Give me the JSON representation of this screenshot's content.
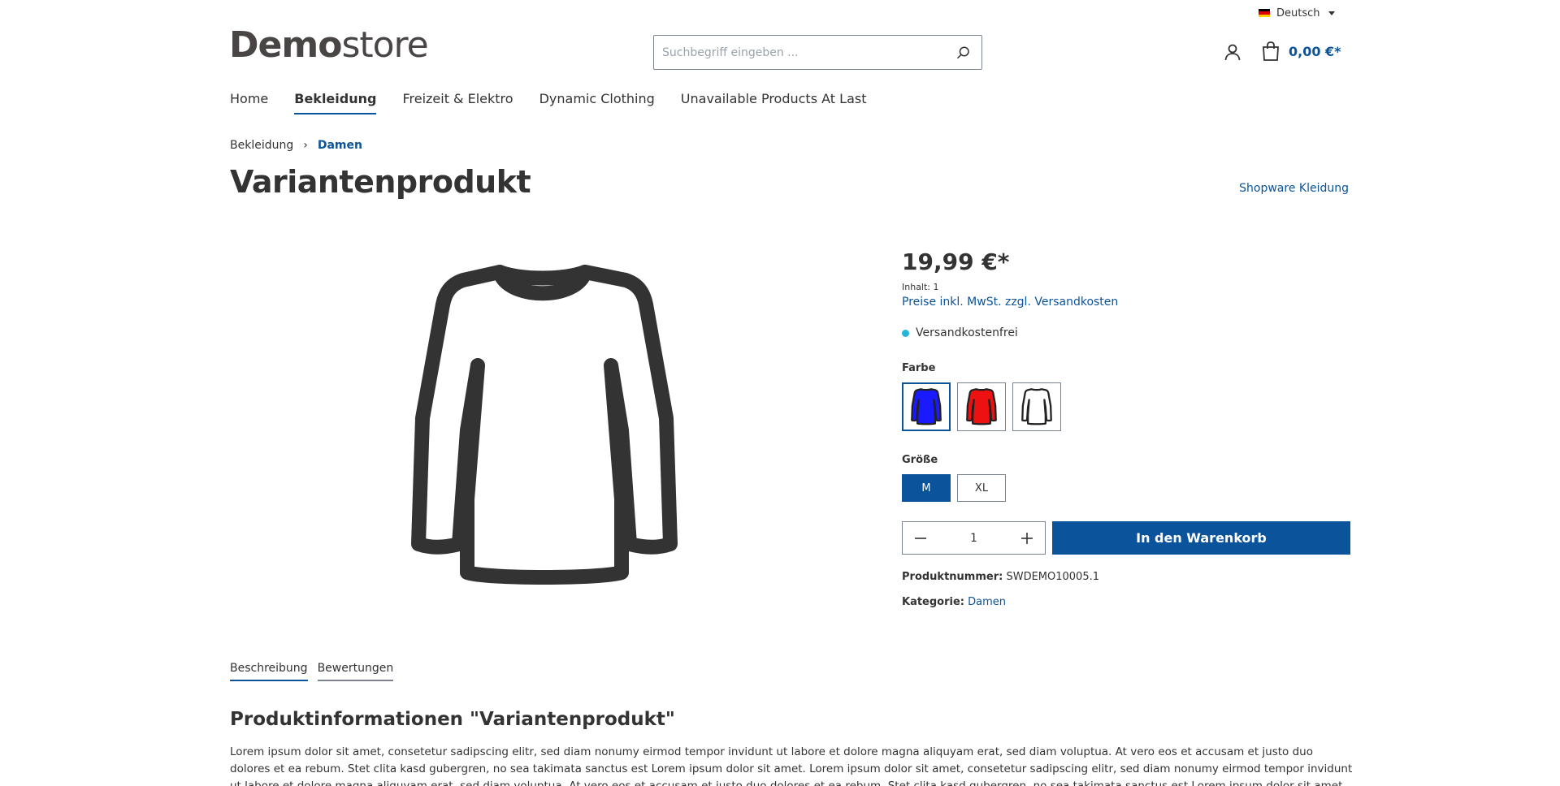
{
  "language": {
    "label": "Deutsch",
    "flag_colors": [
      "#000000",
      "#dd0000",
      "#ffce00"
    ]
  },
  "logo": {
    "bold": "Demo",
    "light": "store"
  },
  "search": {
    "placeholder": "Suchbegriff eingeben ..."
  },
  "cart": {
    "total": "0,00 €*"
  },
  "nav": {
    "items": [
      {
        "label": "Home",
        "active": false
      },
      {
        "label": "Bekleidung",
        "active": true
      },
      {
        "label": "Freizeit & Elektro",
        "active": false
      },
      {
        "label": "Dynamic Clothing",
        "active": false
      },
      {
        "label": "Unavailable Products At Last",
        "active": false
      }
    ]
  },
  "breadcrumb": {
    "parent": "Bekleidung",
    "separator": "›",
    "current": "Damen"
  },
  "product": {
    "title": "Variantenprodukt",
    "manufacturer": "Shopware Kleidung",
    "price": "19,99 €*",
    "unit": "Inhalt: 1",
    "tax_note": "Preise inkl. MwSt. zzgl. Versandkosten",
    "delivery": "Versandkostenfrei",
    "delivery_color": "#26b4d9",
    "color_group": "Farbe",
    "colors": [
      {
        "name": "blue",
        "fill": "#1a1aff",
        "selected": true
      },
      {
        "name": "red",
        "fill": "#ee1111",
        "selected": false
      },
      {
        "name": "white",
        "fill": "#ffffff",
        "selected": false
      }
    ],
    "size_group": "Größe",
    "sizes": [
      {
        "label": "M",
        "selected": true
      },
      {
        "label": "XL",
        "selected": false
      }
    ],
    "quantity": "1",
    "add_to_cart": "In den Warenkorb",
    "number_label": "Produktnummer:",
    "number_value": "SWDEMO10005.1",
    "category_label": "Kategorie:",
    "category_value": "Damen"
  },
  "tabs": [
    {
      "label": "Beschreibung",
      "active": true
    },
    {
      "label": "Bewertungen",
      "active": false
    }
  ],
  "description": {
    "heading": "Produktinformationen \"Variantenprodukt\"",
    "text": "Lorem ipsum dolor sit amet, consetetur sadipscing elitr, sed diam nonumy eirmod tempor invidunt ut labore et dolore magna aliquyam erat, sed diam voluptua. At vero eos et accusam et justo duo dolores et ea rebum. Stet clita kasd gubergren, no sea takimata sanctus est Lorem ipsum dolor sit amet. Lorem ipsum dolor sit amet, consetetur sadipscing elitr, sed diam nonumy eirmod tempor invidunt ut labore et dolore magna aliquyam erat, sed diam voluptua. At vero eos et accusam et justo duo dolores et ea rebum. Stet clita kasd gubergren, no sea takimata sanctus est Lorem ipsum dolor sit amet."
  },
  "colors": {
    "primary": "#0b539b",
    "text": "#333333",
    "border": "#798490"
  }
}
